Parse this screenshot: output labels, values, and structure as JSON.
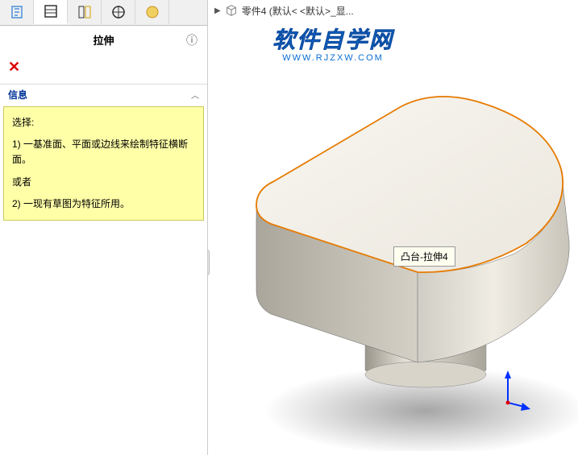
{
  "panel": {
    "title": "拉伸",
    "info_header": "信息",
    "info_select": "选择:",
    "info_line1": "1) 一基准面、平面或边线来绘制特征横断面。",
    "info_or": "或者",
    "info_line2": "2) 一现有草图为特征所用。"
  },
  "viewport": {
    "breadcrumb": "零件4   (默认< <默认>_显...",
    "tooltip": "凸台-拉伸4"
  },
  "watermark": {
    "cn": "软件自学网",
    "url": "WWW.RJZXW.COM"
  },
  "icons": {
    "tab1": "feature-manager-icon",
    "tab2": "property-manager-icon",
    "tab3": "config-manager-icon",
    "tab4": "dimxpert-icon",
    "tab5": "display-manager-icon"
  }
}
